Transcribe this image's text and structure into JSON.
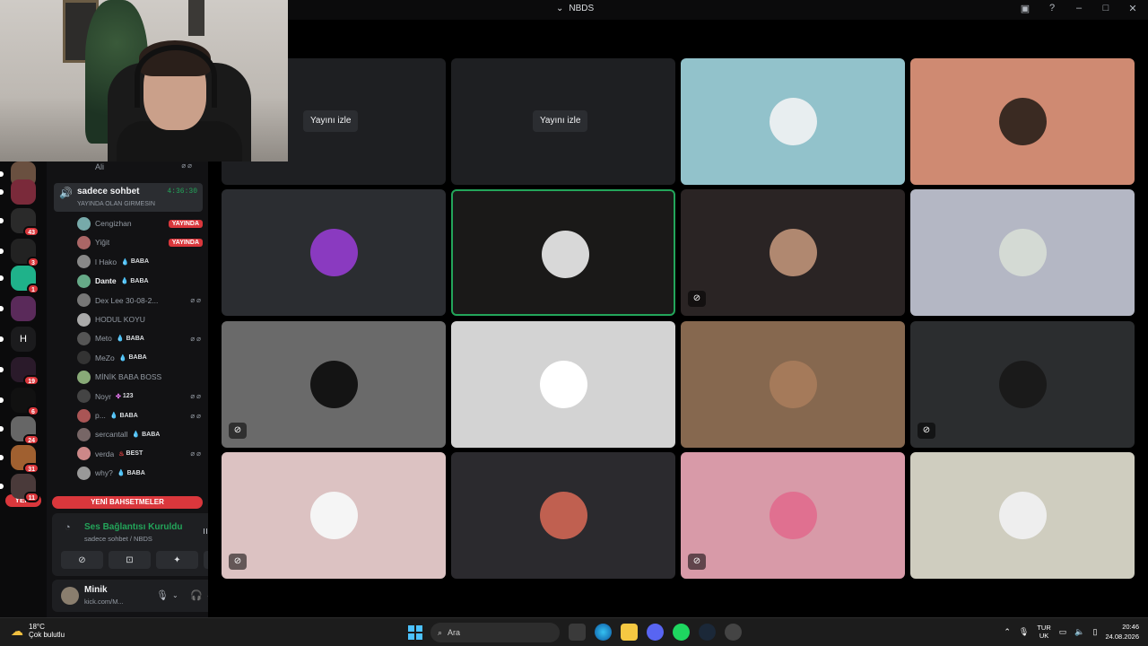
{
  "window": {
    "title": "NBDS"
  },
  "sidebar": {
    "top_member": "Ali",
    "channel": {
      "name": "sadece sohbet",
      "duration": "4:36:30",
      "topic": "YAYINDA OLAN GIRMESIN"
    },
    "members": [
      {
        "name": "Cengizhan",
        "live": "YAYINDA",
        "role": "",
        "bold": false,
        "color": "#7aa"
      },
      {
        "name": "Yiğit",
        "live": "YAYINDA",
        "role": "",
        "bold": false,
        "color": "#a66"
      },
      {
        "name": "l Hako",
        "role": "BABA",
        "bold": false,
        "color": "#888"
      },
      {
        "name": "Dante",
        "role": "BABA",
        "bold": true,
        "color": "#6a8"
      },
      {
        "name": "Dex Lee 30-08-2...",
        "role": "",
        "bold": false,
        "muted": true,
        "color": "#777"
      },
      {
        "name": "HODUL KOYU",
        "role": "",
        "bold": false,
        "color": "#aaa"
      },
      {
        "name": "Meto",
        "role": "BABA",
        "bold": false,
        "muted": true,
        "color": "#555"
      },
      {
        "name": "MeZo",
        "role": "BABA",
        "bold": false,
        "color": "#333"
      },
      {
        "name": "MİNİK BABA BOSS",
        "role": "",
        "bold": false,
        "color": "#8a7"
      },
      {
        "name": "Noyr",
        "role": "123",
        "bold": false,
        "muted": true,
        "color": "#444"
      },
      {
        "name": "p...",
        "role": "BABA",
        "bold": false,
        "muted": true,
        "color": "#a55"
      },
      {
        "name": "sercantall",
        "role": "BABA",
        "bold": false,
        "color": "#766"
      },
      {
        "name": "verda",
        "role": "BEST",
        "bold": false,
        "muted": true,
        "color": "#c88"
      },
      {
        "name": "why?",
        "role": "BABA",
        "bold": false,
        "color": "#999"
      }
    ],
    "new_messages": "YENİ BAHSETMELER",
    "voice_panel": {
      "title": "Ses Bağlantısı Kuruldu",
      "subtitle": "sadece sohbet / NBDS"
    },
    "user": {
      "name": "Minik",
      "status": "kick.com/M..."
    }
  },
  "rail": {
    "new_label": "YENİ",
    "servers": [
      {
        "label": "",
        "badge": "",
        "color": "#6a5040"
      },
      {
        "label": "",
        "badge": "",
        "color": "#7a2a3a"
      },
      {
        "label": "",
        "badge": "43",
        "color": "#2a2a2a"
      },
      {
        "label": "",
        "badge": "3",
        "color": "#222"
      },
      {
        "label": "",
        "badge": "1",
        "color": "#1fb28a"
      },
      {
        "label": "",
        "badge": "",
        "color": "#5a2a5a"
      },
      {
        "label": "H",
        "badge": "",
        "color": "#1b1b1d"
      },
      {
        "label": "",
        "badge": "19",
        "color": "#2a1a2a"
      },
      {
        "label": "",
        "badge": "6",
        "color": "#111"
      },
      {
        "label": "",
        "badge": "24",
        "color": "#666"
      },
      {
        "label": "",
        "badge": "31",
        "color": "#a06030"
      },
      {
        "label": "",
        "badge": "11",
        "color": "#4a3a3a"
      }
    ]
  },
  "stage": {
    "watch_label": "Yayını izle",
    "tiles": [
      {
        "bg": "#1e1f22",
        "watch": true
      },
      {
        "bg": "#1e1f22",
        "watch": true
      },
      {
        "bg": "#92c2cb",
        "avatar": "#e8eef0",
        "watch": false
      },
      {
        "bg": "#cf8a72",
        "avatar": "#3a2a22",
        "watch": false
      },
      {
        "bg": "#2b2d31",
        "avatar": "#8a3ac0",
        "watch": false
      },
      {
        "bg": "#1a1918",
        "avatar": "#d8d8d8",
        "watch": false,
        "speaking": true
      },
      {
        "bg": "#2a2424",
        "avatar": "#b08870",
        "watch": false,
        "muted": true
      },
      {
        "bg": "#b4b7c4",
        "avatar": "#d4dad4",
        "watch": false
      },
      {
        "bg": "#6a6a6a",
        "avatar": "#141414",
        "watch": false,
        "muted": true
      },
      {
        "bg": "#d3d3d3",
        "avatar": "#ffffff",
        "watch": false
      },
      {
        "bg": "#86684f",
        "avatar": "#a57a5a",
        "watch": false
      },
      {
        "bg": "#2b2d2f",
        "avatar": "#1a1a1a",
        "watch": false,
        "muted": true
      },
      {
        "bg": "#dcc2c2",
        "avatar": "#f5f5f5",
        "watch": false,
        "muted": true
      },
      {
        "bg": "#2b2a2e",
        "avatar": "#c06050",
        "watch": false
      },
      {
        "bg": "#d89aa8",
        "avatar": "#e07090",
        "watch": false,
        "muted": true
      },
      {
        "bg": "#cfcdbf",
        "avatar": "#eeeeee",
        "watch": false
      }
    ]
  },
  "taskbar": {
    "weather_temp": "18°C",
    "weather_desc": "Çok bulutlu",
    "search_placeholder": "Ara",
    "lang_top": "TUR",
    "lang_bottom": "UK",
    "time": "20:46",
    "date": "24.08.2026"
  }
}
